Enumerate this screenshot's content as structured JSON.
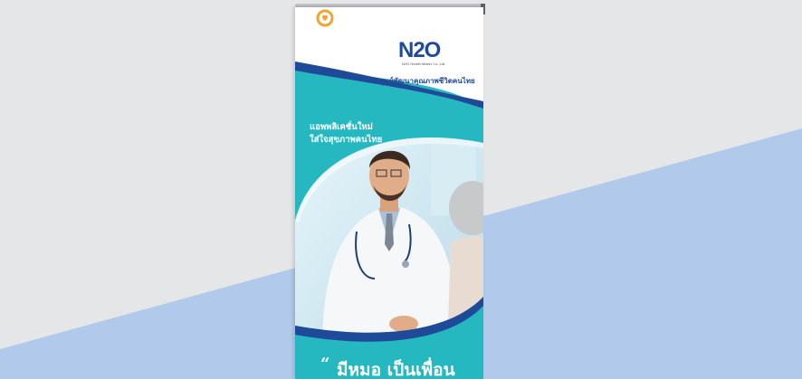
{
  "banner": {
    "logo_text": "N2O",
    "logo_sub": "N2O Health Maker Co.,Ltd.",
    "org_name": "ศูนย์พัฒนาคุณภาพชีวิตคนไทย",
    "tagline_line1": "แอพพลิเคชั่นใหม่",
    "tagline_line2": "ใส่ใจสุขภาพคนไทย",
    "quote_mark": "“",
    "quote_text": "มีหมอ เป็นเพื่อน"
  },
  "colors": {
    "teal": "#26b8c0",
    "navy": "#1e4a98",
    "white": "#ffffff",
    "stripe": "#b1c9ea",
    "background": "#e5e6e8"
  }
}
